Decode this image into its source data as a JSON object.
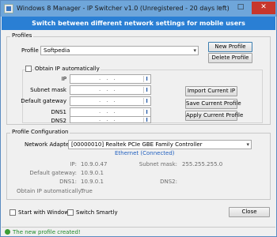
{
  "window": {
    "title": "Windows 8 Manager - IP Switcher v1.0 (Unregistered - 20 days left)"
  },
  "banner": {
    "text": "Switch between different network settings for mobile users"
  },
  "profiles": {
    "group_label": "Profiles",
    "profile_label": "Profile",
    "profile_value": "Softpedia",
    "new_profile": "New Profile",
    "delete_profile": "Delete Profile"
  },
  "ip_settings": {
    "obtain_label": "Obtain IP automatically",
    "fields": [
      {
        "label": "IP"
      },
      {
        "label": "Subnet mask"
      },
      {
        "label": "Default gateway"
      },
      {
        "label": "DNS1"
      },
      {
        "label": "DNS2"
      }
    ],
    "import_button": "Import Current IP",
    "save_button": "Save Current Profile",
    "apply_button": "Apply Current Profile"
  },
  "profile_config": {
    "group_label": "Profile Configuration",
    "adapter_label": "Network Adapter",
    "adapter_value": "[00000010] Realtek PCIe GBE Family Controller",
    "connection_status": "Ethernet (Connected)",
    "info": {
      "ip_label": "IP:",
      "ip_value": "10.9.0.47",
      "subnet_label": "Subnet mask:",
      "subnet_value": "255.255.255.0",
      "gateway_label": "Default gateway:",
      "gateway_value": "10.9.0.1",
      "dns1_label": "DNS1:",
      "dns1_value": "10.9.0.1",
      "dns2_label": "DNS2:",
      "dns2_value": "",
      "obtain_label": "Obtain IP automatically:",
      "obtain_value": "True"
    }
  },
  "footer": {
    "start_with_windows": "Start with Windows",
    "switch_smartly": "Switch Smartly",
    "close": "Close"
  },
  "status": {
    "text": "The new profile created!"
  }
}
